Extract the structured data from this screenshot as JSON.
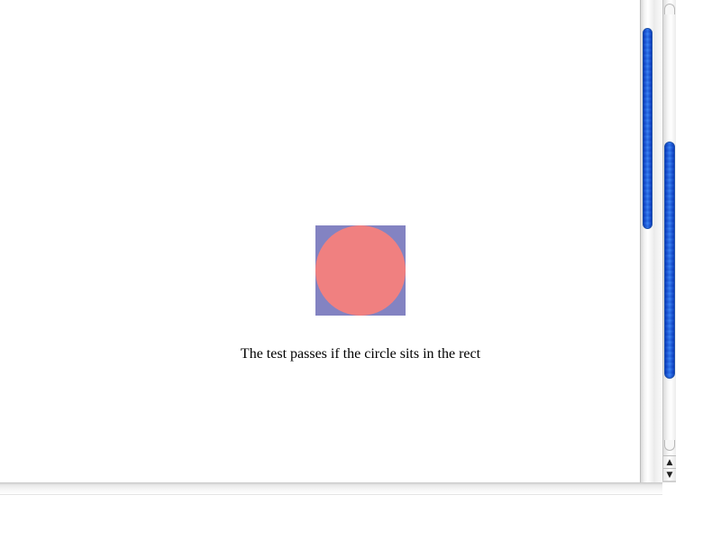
{
  "page": {
    "caption": "The test passes if the circle sits in the rect"
  },
  "colors": {
    "rect_fill": "#8383c2",
    "circle_fill": "#f08080",
    "scroll_thumb": "#4a8fe6"
  },
  "scrollbars": {
    "outer": {
      "up_arrow": "▲",
      "down_arrow": "▼"
    }
  }
}
